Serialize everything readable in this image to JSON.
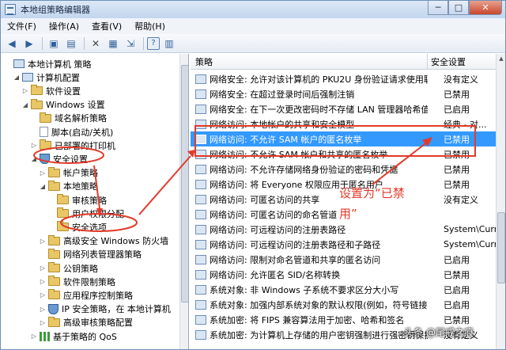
{
  "window": {
    "title": "本地组策略编辑器",
    "btn_min": "─",
    "btn_max": "□",
    "btn_close": "✕"
  },
  "menu": [
    "文件(F)",
    "操作(A)",
    "查看(V)",
    "帮助(H)"
  ],
  "tree": [
    {
      "label": "本地计算机 策略",
      "icon": "computer-icon",
      "indent": 0,
      "tw": ""
    },
    {
      "label": "计算机配置",
      "icon": "computer-icon",
      "indent": 1,
      "tw": "◢"
    },
    {
      "label": "软件设置",
      "icon": "folder-icon",
      "indent": 2,
      "tw": "▷"
    },
    {
      "label": "Windows 设置",
      "icon": "folder-icon",
      "indent": 2,
      "tw": "◢"
    },
    {
      "label": "域名解析策略",
      "icon": "folder-icon",
      "indent": 3,
      "tw": ""
    },
    {
      "label": "脚本(启动/关机)",
      "icon": "document-icon",
      "indent": 3,
      "tw": ""
    },
    {
      "label": "已部署的打印机",
      "icon": "folder-icon",
      "indent": 3,
      "tw": "▷"
    },
    {
      "label": "安全设置",
      "icon": "shield-icon",
      "indent": 3,
      "tw": "◢"
    },
    {
      "label": "帐户策略",
      "icon": "folder-icon",
      "indent": 4,
      "tw": "▷"
    },
    {
      "label": "本地策略",
      "icon": "folder-icon",
      "indent": 4,
      "tw": "◢"
    },
    {
      "label": "审核策略",
      "icon": "folder-icon",
      "indent": 5,
      "tw": ""
    },
    {
      "label": "用户权限分配",
      "icon": "folder-icon",
      "indent": 5,
      "tw": ""
    },
    {
      "label": "安全选项",
      "icon": "folder-icon",
      "indent": 5,
      "tw": ""
    },
    {
      "label": "高级安全 Windows 防火墙",
      "icon": "folder-icon",
      "indent": 4,
      "tw": "▷"
    },
    {
      "label": "网络列表管理器策略",
      "icon": "folder-icon",
      "indent": 4,
      "tw": ""
    },
    {
      "label": "公钥策略",
      "icon": "folder-icon",
      "indent": 4,
      "tw": "▷"
    },
    {
      "label": "软件限制策略",
      "icon": "folder-icon",
      "indent": 4,
      "tw": "▷"
    },
    {
      "label": "应用程序控制策略",
      "icon": "folder-icon",
      "indent": 4,
      "tw": "▷"
    },
    {
      "label": "IP 安全策略，在 本地计算机",
      "icon": "shield-icon",
      "indent": 4,
      "tw": "▷"
    },
    {
      "label": "高级审核策略配置",
      "icon": "folder-icon",
      "indent": 4,
      "tw": "▷"
    },
    {
      "label": "基于策略的 QoS",
      "icon": "qos-icon",
      "indent": 3,
      "tw": "▷"
    }
  ],
  "columns": {
    "policy": "策略",
    "setting": "安全设置"
  },
  "policies": [
    {
      "name": "网络安全: 允许对该计算机的 PKU2U 身份验证请求使用联...",
      "value": "没有定义"
    },
    {
      "name": "网络安全: 在超过登录时间后强制注销",
      "value": "已禁用"
    },
    {
      "name": "网络安全: 在下一次更改密码时不存储 LAN 管理器哈希值",
      "value": "已启用"
    },
    {
      "name": "网络访问: 本地帐户的共享和安全模型",
      "value": "经典 - 对..."
    },
    {
      "name": "网络访问: 不允许 SAM 帐户的匿名枚举",
      "value": "已禁用",
      "selected": true
    },
    {
      "name": "网络访问: 不允许 SAM 帐户和共享的匿名枚举",
      "value": "已禁用"
    },
    {
      "name": "网络访问: 不允许存储网络身份验证的密码和凭据",
      "value": "已禁用"
    },
    {
      "name": "网络访问: 将 Everyone 权限应用于匿名用户",
      "value": "已禁用"
    },
    {
      "name": "网络访问: 可匿名访问的共享",
      "value": "没有定义"
    },
    {
      "name": "网络访问: 可匿名访问的命名管道",
      "value": ""
    },
    {
      "name": "网络访问: 可远程访问的注册表路径",
      "value": "System\\CurrentC..."
    },
    {
      "name": "网络访问: 可远程访问的注册表路径和子路径",
      "value": "System\\CurrentC..."
    },
    {
      "name": "网络访问: 限制对命名管道和共享的匿名访问",
      "value": "已启用"
    },
    {
      "name": "网络访问: 允许匿名 SID/名称转换",
      "value": "已禁用"
    },
    {
      "name": "系统对象: 非 Windows 子系统不要求区分大小写",
      "value": "已启用"
    },
    {
      "name": "系统对象: 加强内部系统对象的默认权限(例如，符号链接)",
      "value": "已启用"
    },
    {
      "name": "系统加密: 将 FIPS 兼容算法用于加密、哈希和签名",
      "value": "已禁用"
    },
    {
      "name": "系统加密: 为计算机上存储的用户密钥强制进行强密钥保护",
      "value": "没有定义"
    }
  ],
  "annotation": {
    "line1": "设置为“已禁",
    "line2": "用”"
  },
  "watermark": "头条 @尾戒之痕",
  "colors": {
    "selection": "#3399ff",
    "annotation": "#e23a2a"
  }
}
